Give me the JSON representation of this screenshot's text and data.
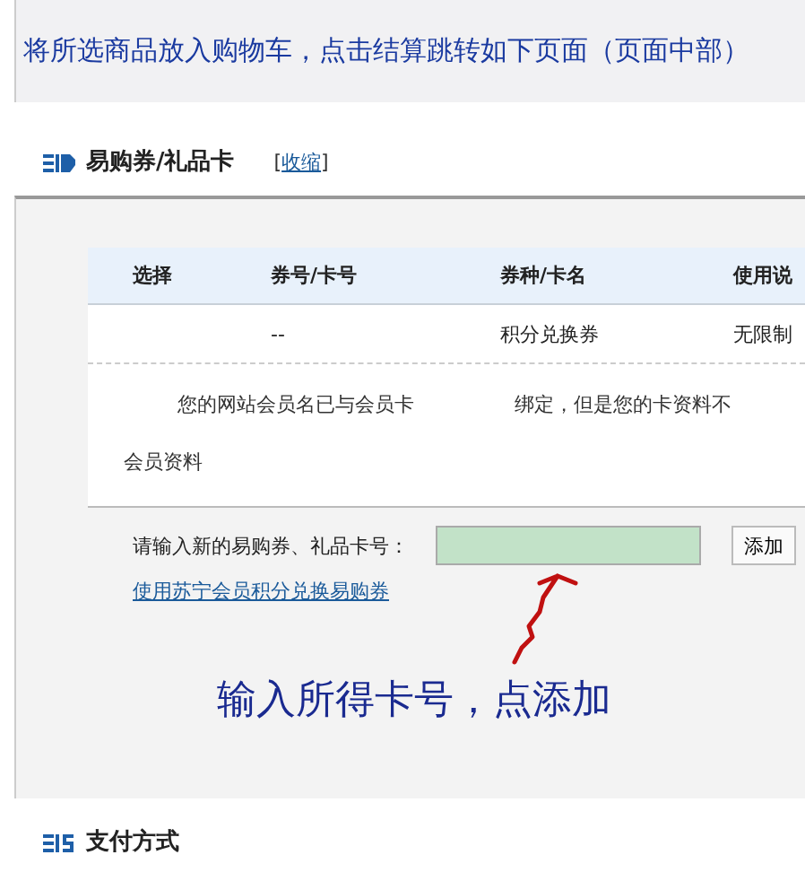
{
  "banner": {
    "text": "将所选商品放入购物车，点击结算跳转如下页面（页面中部）"
  },
  "coupon_section": {
    "title": "易购券/礼品卡",
    "toggle": {
      "left": "[",
      "link": "收缩",
      "right": "]"
    },
    "table": {
      "columns": [
        "选择",
        "券号/卡号",
        "券种/卡名",
        "使用说"
      ],
      "rows": [
        {
          "card_no": "--",
          "card_type": "积分兑换券",
          "usage": "无限制"
        }
      ]
    },
    "notice": {
      "part_1": "您的网站会员名已与会员卡",
      "part_2": "绑定，但是您的卡资料不",
      "part_3": "会员资料"
    },
    "input": {
      "label": "请输入新的易购券、礼品卡号：",
      "button": "添加"
    },
    "link": "使用苏宁会员积分兑换易购券"
  },
  "annotation": {
    "text": "输入所得卡号，点添加"
  },
  "payment_section": {
    "title": "支付方式"
  }
}
